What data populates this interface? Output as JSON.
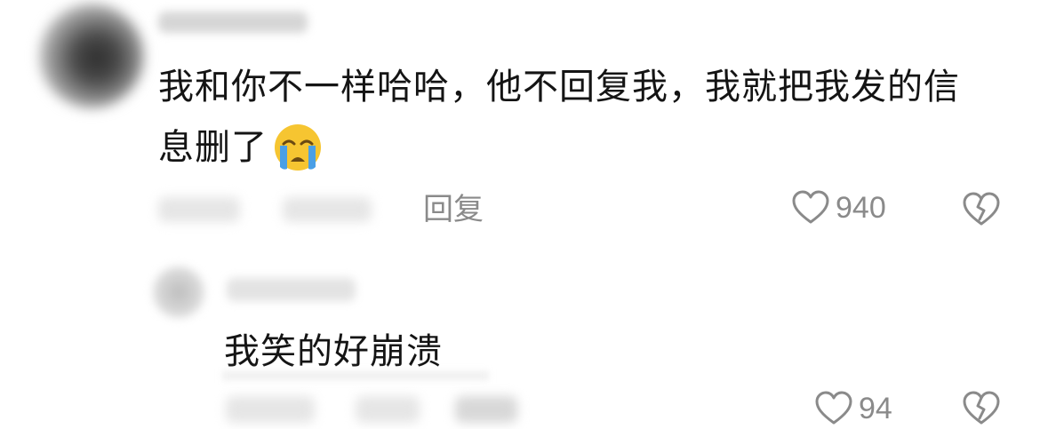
{
  "comment": {
    "line1": "我和你不一样哈哈，他不回复我，我就把我发的信",
    "line2": "息删了",
    "emoji_icon": "loudly-crying-face-icon",
    "reply_label": "回复",
    "like_count": "940",
    "like_icon": "heart-outline-icon",
    "dislike_icon": "broken-heart-icon"
  },
  "reply": {
    "text": "我笑的好崩溃",
    "like_count": "94",
    "like_icon": "heart-outline-icon",
    "dislike_icon": "broken-heart-icon"
  },
  "colors": {
    "text": "#141414",
    "muted": "#8a8a8a",
    "emoji_face": "#f6c531",
    "emoji_tears": "#4a9fe6"
  }
}
